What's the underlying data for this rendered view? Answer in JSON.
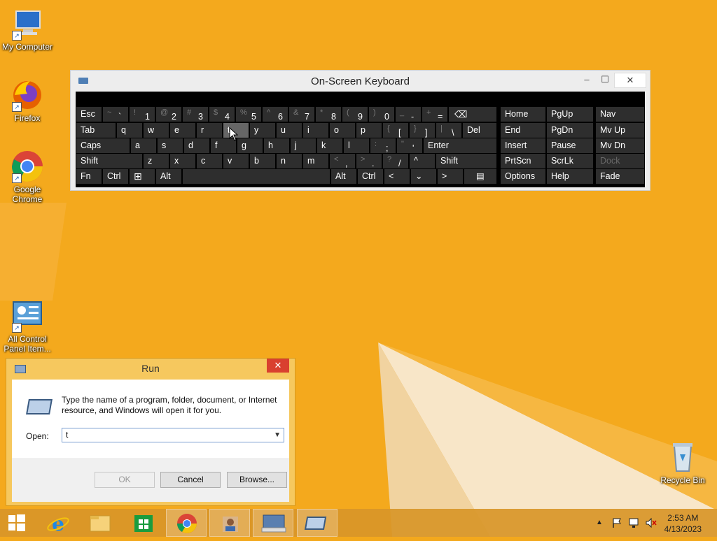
{
  "desktop": {
    "icons": [
      {
        "label": "My Computer"
      },
      {
        "label": "Firefox"
      },
      {
        "label": "Google Chrome"
      },
      {
        "label": "All Control Panel Item..."
      },
      {
        "label": "Recycle Bin"
      }
    ]
  },
  "osk": {
    "title": "On-Screen Keyboard",
    "controls": {
      "minimize": "–",
      "maximize": "☐",
      "close": "✕"
    },
    "keys": {
      "esc": "Esc",
      "tilde_s": "~",
      "tilde_m": "`",
      "1s": "!",
      "1": "1",
      "2s": "@",
      "2": "2",
      "3s": "#",
      "3": "3",
      "4s": "$",
      "4": "4",
      "5s": "%",
      "5": "5",
      "6s": "^",
      "6": "6",
      "7s": "&",
      "7": "7",
      "8s": "*",
      "8": "8",
      "9s": "(",
      "9": "9",
      "0s": ")",
      "0": "0",
      "minus_s": "_",
      "minus": "-",
      "eq_s": "+",
      "eq": "=",
      "back": "⌫",
      "tab": "Tab",
      "q": "q",
      "w": "w",
      "e": "e",
      "r": "r",
      "t": "t",
      "y": "y",
      "u": "u",
      "i": "i",
      "o": "o",
      "p": "p",
      "lb_s": "{",
      "lb": "[",
      "rb_s": "}",
      "rb": "]",
      "bs_s": "|",
      "bs": "\\",
      "del": "Del",
      "caps": "Caps",
      "a": "a",
      "s": "s",
      "d": "d",
      "f": "f",
      "g": "g",
      "h": "h",
      "j": "j",
      "k": "k",
      "l": "l",
      "semi_s": ":",
      "semi": ";",
      "quote_s": "\"",
      "quote": "'",
      "enter": "Enter",
      "shift": "Shift",
      "z": "z",
      "x": "x",
      "c": "c",
      "v": "v",
      "b": "b",
      "n": "n",
      "m": "m",
      "comma_s": "<",
      "comma": ",",
      "dot_s": ">",
      "dot": ".",
      "slash_s": "?",
      "slash": "/",
      "up": "^",
      "rshift": "Shift",
      "fn": "Fn",
      "ctrl": "Ctrl",
      "win": "⊞",
      "alt": "Alt",
      "ralt": "Alt",
      "rctrl": "Ctrl",
      "left": "<",
      "down": "⌄",
      "right": ">",
      "menu": "▤",
      "home": "Home",
      "pgup": "PgUp",
      "nav": "Nav",
      "end": "End",
      "pgdn": "PgDn",
      "mvup": "Mv Up",
      "insert": "Insert",
      "pause": "Pause",
      "mvdn": "Mv Dn",
      "prtscn": "PrtScn",
      "scrlk": "ScrLk",
      "dock": "Dock",
      "options": "Options",
      "help": "Help",
      "fade": "Fade"
    }
  },
  "run": {
    "title": "Run",
    "close": "✕",
    "message": "Type the name of a program, folder, document, or Internet resource, and Windows will open it for you.",
    "open_label": "Open:",
    "open_value": "t",
    "ok": "OK",
    "cancel": "Cancel",
    "browse": "Browse..."
  },
  "taskbar": {
    "clock_time": "2:53 AM",
    "clock_date": "4/13/2023",
    "tray_up": "▲"
  }
}
